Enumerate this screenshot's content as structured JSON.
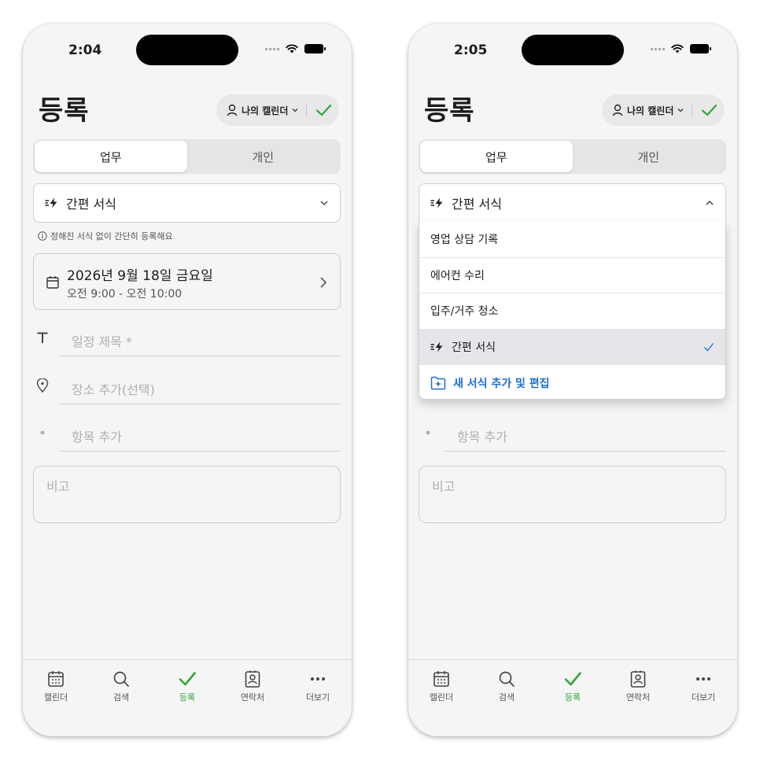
{
  "screens": [
    {
      "status": {
        "time": "2:04"
      },
      "header": {
        "title": "등록",
        "calendar_name": "나의 캘린더"
      },
      "tabs": [
        "업무",
        "개인"
      ],
      "template": {
        "label": "간편 서식",
        "hint": "정해진 서식 없이 간단히 등록해요"
      },
      "date": {
        "main": "2026년 9월 18일 금요일",
        "time": "오전 9:00 - 오전 10:00"
      },
      "fields": {
        "title_placeholder": "일정 제목 *",
        "location_placeholder": "장소 추가(선택)",
        "item_placeholder": "항목 추가",
        "memo_placeholder": "비고"
      },
      "tabbar": [
        "캘린더",
        "검색",
        "등록",
        "연락처",
        "더보기"
      ]
    },
    {
      "status": {
        "time": "2:05"
      },
      "header": {
        "title": "등록",
        "calendar_name": "나의 캘린더"
      },
      "tabs": [
        "업무",
        "개인"
      ],
      "template": {
        "label": "간편 서식"
      },
      "dropdown": {
        "items": [
          "영업 상담 기록",
          "에어컨 수리",
          "입주/거주 청소",
          "간편 서식"
        ],
        "selected": "간편 서식",
        "add_label": "새 서식 추가 및 편집"
      },
      "fields": {
        "item_placeholder": "항목 추가",
        "memo_placeholder": "비고"
      },
      "tabbar": [
        "캘린더",
        "검색",
        "등록",
        "연락처",
        "더보기"
      ]
    }
  ],
  "colors": {
    "accent_green": "#36a33b",
    "link_blue": "#1e6fcf",
    "background": "#f5f5f5"
  }
}
